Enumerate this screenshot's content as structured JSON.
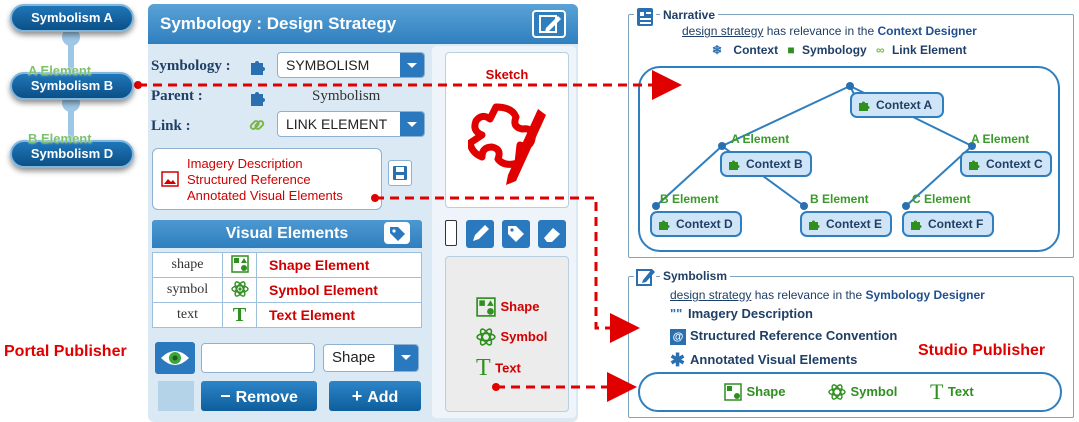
{
  "left_tree": {
    "nodes": [
      "Symbolism A",
      "Symbolism B",
      "Symbolism D"
    ],
    "link_labels": [
      "A Element",
      "B Element"
    ]
  },
  "panel": {
    "title": "Symbology : Design Strategy",
    "symbology_label": "Symbology :",
    "symbology_value": "SYMBOLISM",
    "parent_label": "Parent :",
    "parent_value": "Symbolism",
    "link_label": "Link :",
    "link_value": "LINK ELEMENT",
    "description_lines": [
      "Imagery Description",
      "Structured Reference",
      "Annotated Visual Elements"
    ],
    "visual_elements_title": "Visual Elements",
    "visual_elements": [
      {
        "name": "shape",
        "label": "Shape Element"
      },
      {
        "name": "symbol",
        "label": "Symbol Element"
      },
      {
        "name": "text",
        "label": "Text Element"
      }
    ],
    "input_placeholder": "",
    "type_select": "Shape",
    "remove_label": "Remove",
    "add_label": "Add"
  },
  "sketch": {
    "title": "Sketch",
    "tools": [
      "Shape",
      "Symbol",
      "Text"
    ]
  },
  "labels": {
    "portal_publisher": "Portal Publisher",
    "studio_publisher": "Studio Publisher"
  },
  "narrative": {
    "title": "Narrative",
    "link_text": "design strategy",
    "sentence_mid": " has relevance in the ",
    "target": "Context Designer",
    "legend": [
      "Context",
      "Symbology",
      "Link Element"
    ],
    "contexts": [
      "Context A",
      "Context B",
      "Context C",
      "Context D",
      "Context E",
      "Context F"
    ],
    "edge_labels": [
      "A Element",
      "A Element",
      "B Element",
      "B Element",
      "C Element"
    ]
  },
  "symbolism": {
    "title": "Symbolism",
    "link_text": "design strategy",
    "sentence_mid": " has relevance in the ",
    "target": "Symbology Designer",
    "items": [
      "Imagery Description",
      "Structured Reference Convention",
      "Annotated Visual Elements"
    ],
    "quote_glyph": "\"\"",
    "bar_items": [
      "Shape",
      "Symbol",
      "Text"
    ]
  },
  "colors": {
    "accent_blue": "#2f7fbf",
    "red": "#e00000",
    "green": "#2f8f1f"
  }
}
